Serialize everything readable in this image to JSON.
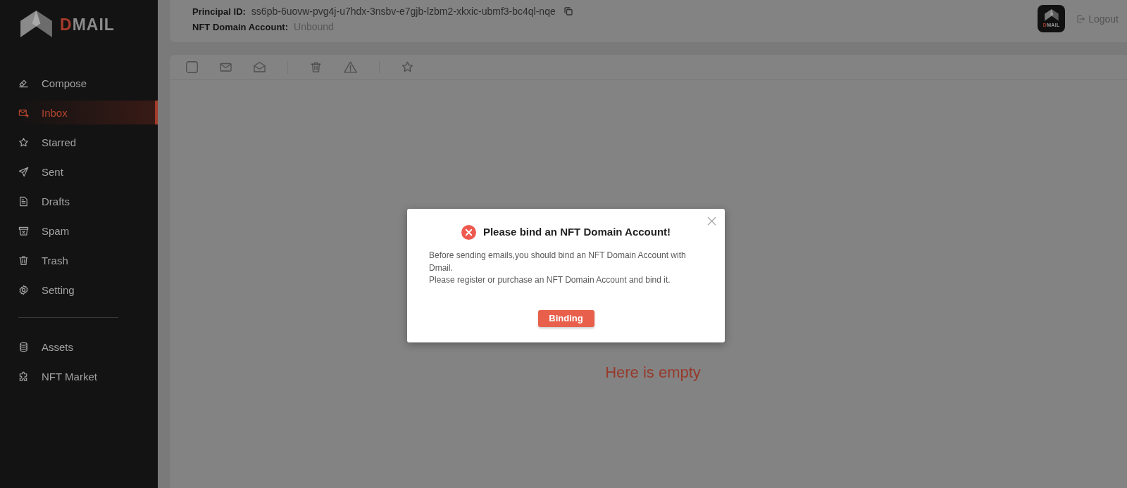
{
  "sidebar": {
    "logo_text": "DMAIL",
    "nav_groups": [
      {
        "items": [
          {
            "label": "Compose",
            "selected": false
          },
          {
            "label": "Inbox",
            "selected": true
          },
          {
            "label": "Starred",
            "selected": false
          },
          {
            "label": "Sent",
            "selected": false
          },
          {
            "label": "Drafts",
            "selected": false
          },
          {
            "label": "Spam",
            "selected": false
          },
          {
            "label": "Trash",
            "selected": false
          },
          {
            "label": "Setting",
            "selected": false
          }
        ]
      },
      {
        "items": [
          {
            "label": "Assets",
            "selected": false
          },
          {
            "label": "NFT Market",
            "selected": false
          }
        ]
      }
    ]
  },
  "header": {
    "principal_id": {
      "label": "Principal ID:",
      "value": "ss6pb-6uovw-pvg4j-u7hdx-3nsbv-e7gjb-lzbm2-xkxic-ubmf3-bc4ql-nqe"
    },
    "nft_domain_account": {
      "label": "NFT Domain Account:",
      "value": "Unbound"
    },
    "avatar_text": "DMAIL",
    "logout": "Logout"
  },
  "toolbar": {
    "select_all_checked": false
  },
  "empty_message": "Here is empty",
  "dialog": {
    "title": "Please bind an NFT Domain Account!",
    "body": [
      "Before sending emails,you should bind an NFT Domain Account with Dmail.",
      "Please register or purchase an NFT Domain Account and bind it."
    ],
    "button": "Binding"
  }
}
